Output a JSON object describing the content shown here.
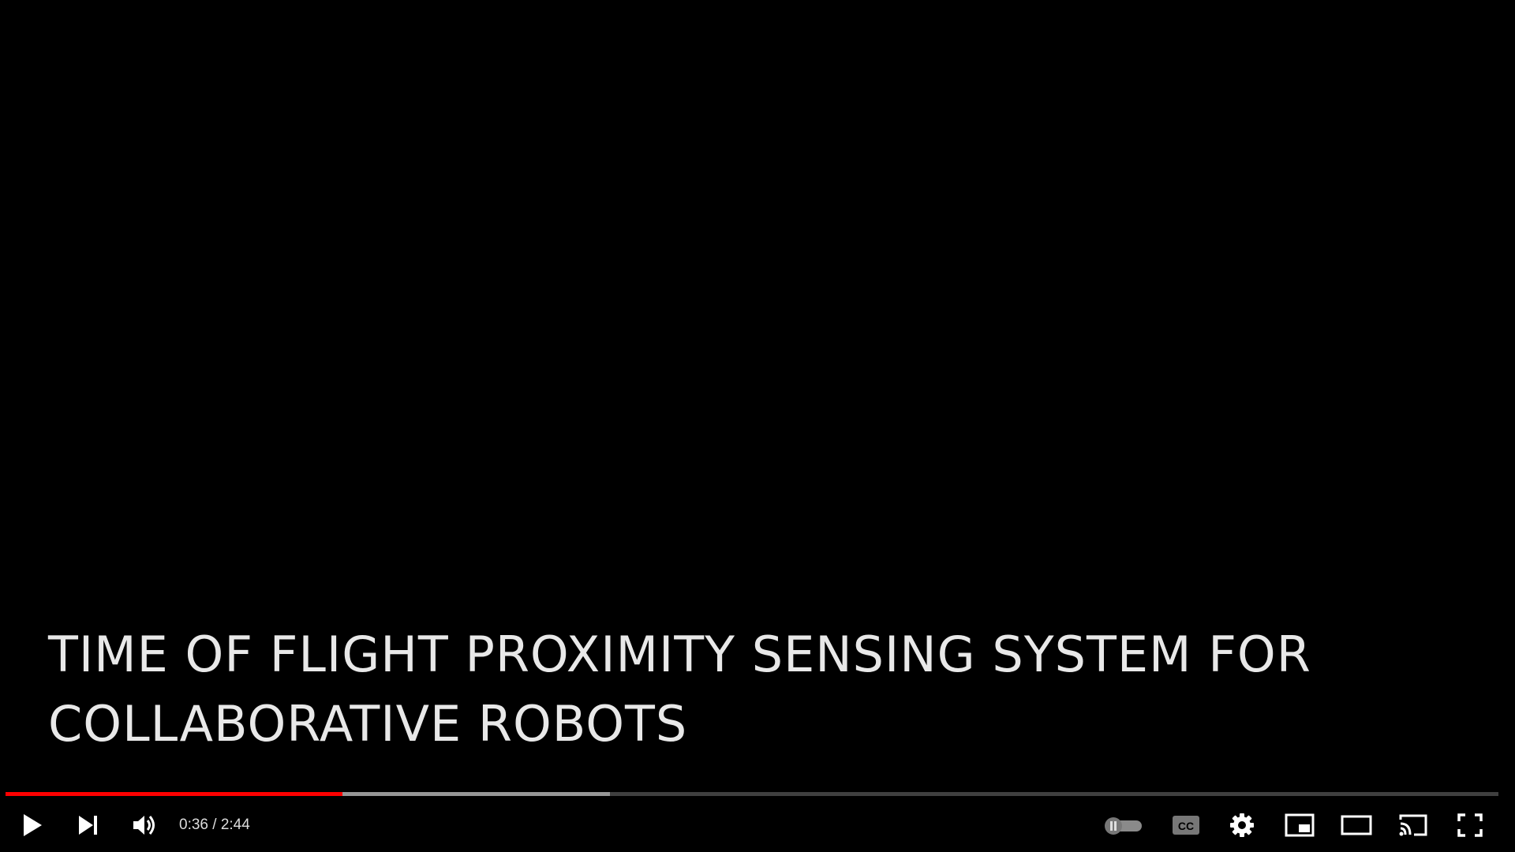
{
  "video": {
    "title_line_1": "TIME OF FLIGHT PROXIMITY SENSING SYSTEM FOR",
    "title_line_2": "COLLABORATIVE ROBOTS"
  },
  "progress": {
    "played_fraction": 0.2257,
    "loaded_fraction": 0.4046,
    "played_color": "#ff0000"
  },
  "controls": {
    "current_time": "0:36",
    "separator": " / ",
    "duration": "2:44",
    "icons": {
      "play": "play-icon",
      "next": "next-icon",
      "volume": "volume-icon",
      "autoplay": "autoplay-toggle-icon",
      "captions": "captions-icon",
      "settings": "gear-icon",
      "miniplayer": "miniplayer-icon",
      "theater": "theater-mode-icon",
      "cast": "cast-icon",
      "fullscreen": "fullscreen-icon"
    }
  }
}
